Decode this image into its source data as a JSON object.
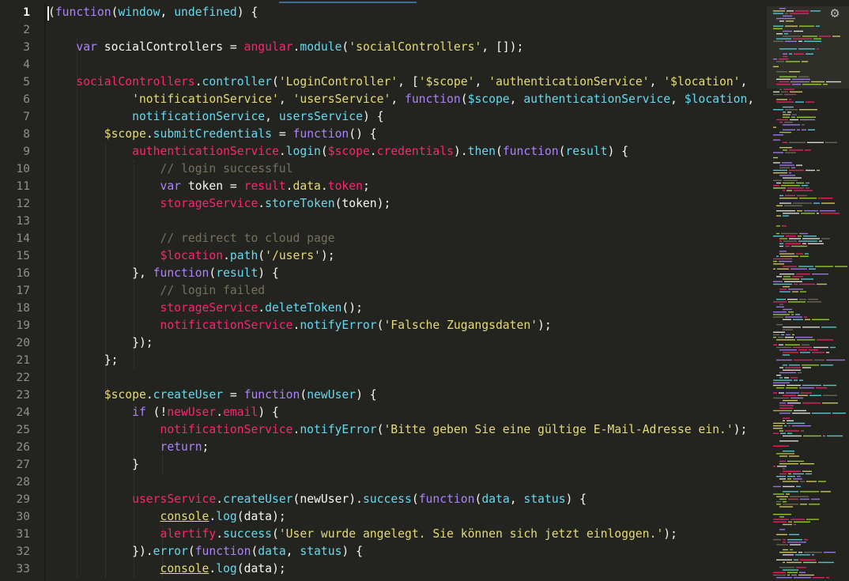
{
  "editor": {
    "active_line": "1",
    "settings_icon": "gear-icon",
    "colors": {
      "background": "#23241f",
      "plain": "#f8f8f2",
      "keyword": "#ae81ff",
      "function": "#66d9ef",
      "identifier": "#f92672",
      "string": "#e6db74",
      "comment": "#75715e"
    }
  },
  "line_numbers": [
    "1",
    "2",
    "3",
    "4",
    "5",
    "6",
    "7",
    "8",
    "9",
    "10",
    "11",
    "12",
    "13",
    "14",
    "15",
    "16",
    "17",
    "18",
    "19",
    "20",
    "21",
    "22",
    "23",
    "24",
    "25",
    "26",
    "27",
    "28",
    "29",
    "30",
    "31",
    "32",
    "33"
  ],
  "lines": [
    [
      [
        "p",
        "("
      ],
      [
        "k",
        "function"
      ],
      [
        "p",
        "("
      ],
      [
        "f",
        "window"
      ],
      [
        "p",
        ", "
      ],
      [
        "f",
        "undefined"
      ],
      [
        "p",
        ") {"
      ]
    ],
    [],
    [
      [
        "p",
        "    "
      ],
      [
        "k",
        "var"
      ],
      [
        "p",
        " socialControllers = "
      ],
      [
        "r",
        "angular"
      ],
      [
        "p",
        "."
      ],
      [
        "f",
        "module"
      ],
      [
        "p",
        "("
      ],
      [
        "s",
        "'socialControllers'"
      ],
      [
        "p",
        ", []);"
      ]
    ],
    [],
    [
      [
        "p",
        "    "
      ],
      [
        "r",
        "socialControllers"
      ],
      [
        "p",
        "."
      ],
      [
        "f",
        "controller"
      ],
      [
        "p",
        "("
      ],
      [
        "s",
        "'LoginController'"
      ],
      [
        "p",
        ", ["
      ],
      [
        "s",
        "'$scope'"
      ],
      [
        "p",
        ", "
      ],
      [
        "s",
        "'authenticationService'"
      ],
      [
        "p",
        ", "
      ],
      [
        "s",
        "'$location'"
      ],
      [
        "p",
        ","
      ]
    ],
    [
      [
        "p",
        "            "
      ],
      [
        "s",
        "'notificationService'"
      ],
      [
        "p",
        ", "
      ],
      [
        "s",
        "'usersService'"
      ],
      [
        "p",
        ", "
      ],
      [
        "k",
        "function"
      ],
      [
        "p",
        "("
      ],
      [
        "f",
        "$scope"
      ],
      [
        "p",
        ", "
      ],
      [
        "f",
        "authenticationService"
      ],
      [
        "p",
        ", "
      ],
      [
        "f",
        "$location"
      ],
      [
        "p",
        ","
      ]
    ],
    [
      [
        "p",
        "            "
      ],
      [
        "f",
        "notificationService"
      ],
      [
        "p",
        ", "
      ],
      [
        "f",
        "usersService"
      ],
      [
        "p",
        ") {"
      ]
    ],
    [
      [
        "p",
        "        "
      ],
      [
        "y",
        "$scope"
      ],
      [
        "p",
        "."
      ],
      [
        "f",
        "submitCredentials"
      ],
      [
        "p",
        " = "
      ],
      [
        "k",
        "function"
      ],
      [
        "p",
        "() {"
      ]
    ],
    [
      [
        "p",
        "            "
      ],
      [
        "r",
        "authenticationService"
      ],
      [
        "p",
        "."
      ],
      [
        "f",
        "login"
      ],
      [
        "p",
        "("
      ],
      [
        "r",
        "$scope"
      ],
      [
        "p",
        "."
      ],
      [
        "r",
        "credentials"
      ],
      [
        "p",
        ")."
      ],
      [
        "f",
        "then"
      ],
      [
        "p",
        "("
      ],
      [
        "k",
        "function"
      ],
      [
        "p",
        "("
      ],
      [
        "f",
        "result"
      ],
      [
        "p",
        ") {"
      ]
    ],
    [
      [
        "p",
        "                "
      ],
      [
        "c",
        "// login successful"
      ]
    ],
    [
      [
        "p",
        "                "
      ],
      [
        "k",
        "var"
      ],
      [
        "p",
        " token = "
      ],
      [
        "r",
        "result"
      ],
      [
        "p",
        "."
      ],
      [
        "y",
        "data"
      ],
      [
        "p",
        "."
      ],
      [
        "r",
        "token"
      ],
      [
        "p",
        ";"
      ]
    ],
    [
      [
        "p",
        "                "
      ],
      [
        "r",
        "storageService"
      ],
      [
        "p",
        "."
      ],
      [
        "f",
        "storeToken"
      ],
      [
        "p",
        "(token);"
      ]
    ],
    [],
    [
      [
        "p",
        "                "
      ],
      [
        "c",
        "// redirect to cloud page"
      ]
    ],
    [
      [
        "p",
        "                "
      ],
      [
        "r",
        "$location"
      ],
      [
        "p",
        "."
      ],
      [
        "f",
        "path"
      ],
      [
        "p",
        "("
      ],
      [
        "s",
        "'/users'"
      ],
      [
        "p",
        ");"
      ]
    ],
    [
      [
        "p",
        "            }, "
      ],
      [
        "k",
        "function"
      ],
      [
        "p",
        "("
      ],
      [
        "f",
        "result"
      ],
      [
        "p",
        ") {"
      ]
    ],
    [
      [
        "p",
        "                "
      ],
      [
        "c",
        "// login failed"
      ]
    ],
    [
      [
        "p",
        "                "
      ],
      [
        "r",
        "storageService"
      ],
      [
        "p",
        "."
      ],
      [
        "f",
        "deleteToken"
      ],
      [
        "p",
        "();"
      ]
    ],
    [
      [
        "p",
        "                "
      ],
      [
        "r",
        "notificationService"
      ],
      [
        "p",
        "."
      ],
      [
        "f",
        "notifyError"
      ],
      [
        "p",
        "("
      ],
      [
        "s",
        "'Falsche Zugangsdaten'"
      ],
      [
        "p",
        ");"
      ]
    ],
    [
      [
        "p",
        "            });"
      ]
    ],
    [
      [
        "p",
        "        };"
      ]
    ],
    [],
    [
      [
        "p",
        "        "
      ],
      [
        "y",
        "$scope"
      ],
      [
        "p",
        "."
      ],
      [
        "f",
        "createUser"
      ],
      [
        "p",
        " = "
      ],
      [
        "k",
        "function"
      ],
      [
        "p",
        "("
      ],
      [
        "f",
        "newUser"
      ],
      [
        "p",
        ") {"
      ]
    ],
    [
      [
        "p",
        "            "
      ],
      [
        "k",
        "if"
      ],
      [
        "p",
        " (!"
      ],
      [
        "r",
        "newUser"
      ],
      [
        "p",
        "."
      ],
      [
        "r",
        "email"
      ],
      [
        "p",
        ") {"
      ]
    ],
    [
      [
        "p",
        "                "
      ],
      [
        "r",
        "notificationService"
      ],
      [
        "p",
        "."
      ],
      [
        "f",
        "notifyError"
      ],
      [
        "p",
        "("
      ],
      [
        "s",
        "'Bitte geben Sie eine gültige E-Mail-Adresse ein.'"
      ],
      [
        "p",
        ");"
      ]
    ],
    [
      [
        "p",
        "                "
      ],
      [
        "k",
        "return"
      ],
      [
        "p",
        ";"
      ]
    ],
    [
      [
        "p",
        "            }"
      ]
    ],
    [],
    [
      [
        "p",
        "            "
      ],
      [
        "r",
        "usersService"
      ],
      [
        "p",
        "."
      ],
      [
        "f",
        "createUser"
      ],
      [
        "p",
        "(newUser)."
      ],
      [
        "f",
        "success"
      ],
      [
        "p",
        "("
      ],
      [
        "k",
        "function"
      ],
      [
        "p",
        "("
      ],
      [
        "f",
        "data"
      ],
      [
        "p",
        ", "
      ],
      [
        "f",
        "status"
      ],
      [
        "p",
        ") {"
      ]
    ],
    [
      [
        "p",
        "                "
      ],
      [
        "u",
        "console"
      ],
      [
        "p",
        "."
      ],
      [
        "f",
        "log"
      ],
      [
        "p",
        "(data);"
      ]
    ],
    [
      [
        "p",
        "                "
      ],
      [
        "r",
        "alertify"
      ],
      [
        "p",
        "."
      ],
      [
        "f",
        "success"
      ],
      [
        "p",
        "("
      ],
      [
        "s",
        "'User wurde angelegt. Sie können sich jetzt einloggen.'"
      ],
      [
        "p",
        ");"
      ]
    ],
    [
      [
        "p",
        "            })."
      ],
      [
        "f",
        "error"
      ],
      [
        "p",
        "("
      ],
      [
        "k",
        "function"
      ],
      [
        "p",
        "("
      ],
      [
        "f",
        "data"
      ],
      [
        "p",
        ", "
      ],
      [
        "f",
        "status"
      ],
      [
        "p",
        ") {"
      ]
    ],
    [
      [
        "p",
        "                "
      ],
      [
        "u",
        "console"
      ],
      [
        "p",
        "."
      ],
      [
        "f",
        "log"
      ],
      [
        "p",
        "(data);"
      ]
    ]
  ]
}
